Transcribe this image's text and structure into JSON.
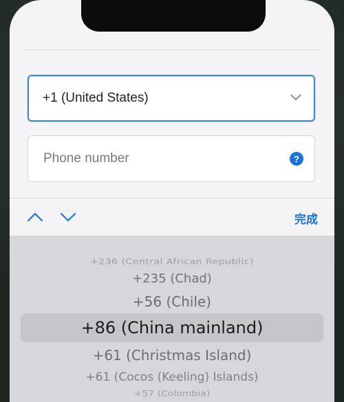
{
  "country_select": {
    "value": "+1 (United States)"
  },
  "phone": {
    "placeholder": "Phone number"
  },
  "toolbar": {
    "done_label": "完成"
  },
  "picker": {
    "items": [
      "+236 (Central African Republic)",
      "+235 (Chad)",
      "+56 (Chile)",
      "+86 (China mainland)",
      "+61 (Christmas Island)",
      "+61 (Cocos (Keeling) Islands)",
      "+57 (Colombia)"
    ],
    "selected_index": 3
  },
  "colors": {
    "accent": "#1a73d9",
    "focus_border": "#3a86c8"
  },
  "icons": {
    "dropdown": "chevron-down-icon",
    "help": "question-circle-icon",
    "prev": "chevron-up-icon",
    "next": "chevron-down-icon"
  }
}
